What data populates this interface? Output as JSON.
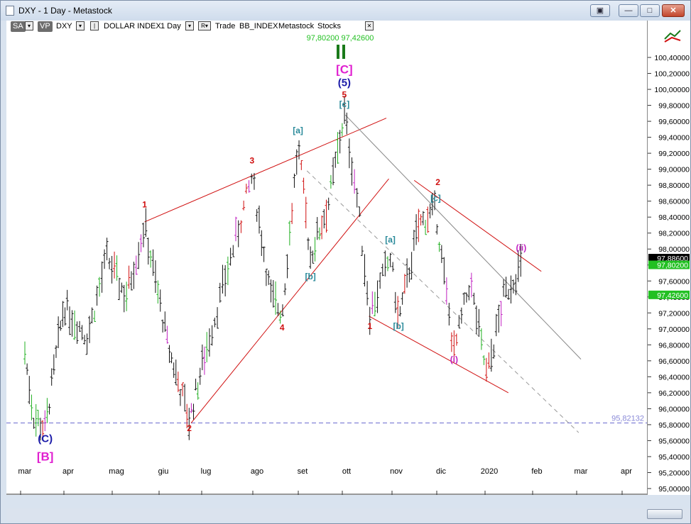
{
  "window": {
    "title": "DXY - 1 Day - Metastock",
    "buttons": [
      "▣",
      "—",
      "□",
      "✕"
    ]
  },
  "toolbar": {
    "sa": "SA",
    "vp": "VP",
    "symbol": "DXY",
    "dd1": "▾",
    "dd2": "▾",
    "name": "DOLLAR INDEX",
    "period": "1 Day",
    "dd3": "▾",
    "rbtn": "R▾",
    "trade": "Trade",
    "source": "BB_INDEX",
    "metastock": "Metastock",
    "stocks": "Stocks",
    "close": "✕",
    "quote_green": "97,80200",
    "quote_green2": "97,42600"
  },
  "chart_data": {
    "type": "ohlc",
    "x_ticks": [
      "mar",
      "apr",
      "mag",
      "giu",
      "lug",
      "ago",
      "set",
      "ott",
      "nov",
      "dic",
      "2020",
      "feb",
      "mar",
      "apr"
    ],
    "y_ticks": [
      "95,00000",
      "95,20000",
      "95,40000",
      "95,60000",
      "95,80000",
      "96,00000",
      "96,20000",
      "96,40000",
      "96,60000",
      "96,80000",
      "97,00000",
      "97,20000",
      "97,40000",
      "97,60000",
      "97,80000",
      "98,00000",
      "98,20000",
      "98,40000",
      "98,60000",
      "98,80000",
      "99,00000",
      "99,20000",
      "99,40000",
      "99,60000",
      "99,80000",
      "100,00000",
      "100,20000",
      "100,40000"
    ],
    "y_range": [
      94.95,
      100.65
    ],
    "price_tags": [
      {
        "value": 97.886,
        "label": "97,88600",
        "bg": "#000000",
        "fg": "#ffffff"
      },
      {
        "value": 97.802,
        "label": "97,80200",
        "bg": "#22c022",
        "fg": "#ffffff"
      },
      {
        "value": 97.426,
        "label": "97,42600",
        "bg": "#22c022",
        "fg": "#ffffff"
      }
    ],
    "support_line": {
      "value": 95.82132,
      "label": "95,82132"
    },
    "wave_labels": [
      {
        "text": "(C)",
        "date_index": 0.47,
        "price": 95.58,
        "color": "#1a1aa8"
      },
      {
        "text": "[B]",
        "date_index": 0.47,
        "price": 95.35,
        "color": "#e020d0"
      },
      {
        "text": "1",
        "date_index": 2.6,
        "price": 98.52,
        "color": "#d01010"
      },
      {
        "text": "2",
        "date_index": 3.61,
        "price": 95.72,
        "color": "#d01010"
      },
      {
        "text": "3",
        "date_index": 4.9,
        "price": 99.07,
        "color": "#d01010"
      },
      {
        "text": "4",
        "date_index": 5.55,
        "price": 96.98,
        "color": "#d01010"
      },
      {
        "text": "[a]",
        "date_index": 5.9,
        "price": 99.45,
        "color": "#2a8a9a"
      },
      {
        "text": "[b]",
        "date_index": 6.18,
        "price": 97.62,
        "color": "#2a8a9a"
      },
      {
        "text": "[c]",
        "date_index": 6.95,
        "price": 99.78,
        "color": "#2a8a9a"
      },
      {
        "text": "5",
        "date_index": 6.95,
        "price": 99.9,
        "color": "#d01010"
      },
      {
        "text": "(5)",
        "date_index": 6.95,
        "price": 100.04,
        "color": "#1a1aa8"
      },
      {
        "text": "[C]",
        "date_index": 6.95,
        "price": 100.2,
        "color": "#e020d0"
      },
      {
        "text": "1",
        "date_index": 7.47,
        "price": 97.0,
        "color": "#d01010"
      },
      {
        "text": "[a]",
        "date_index": 7.88,
        "price": 98.08,
        "color": "#2a8a9a"
      },
      {
        "text": "[b]",
        "date_index": 8.05,
        "price": 97.0,
        "color": "#2a8a9a"
      },
      {
        "text": "[c]",
        "date_index": 8.88,
        "price": 98.6,
        "color": "#2a8a9a"
      },
      {
        "text": "2",
        "date_index": 8.93,
        "price": 98.8,
        "color": "#d01010"
      },
      {
        "text": "(i)",
        "date_index": 9.27,
        "price": 96.58,
        "color": "#c020c0"
      },
      {
        "text": "(ii)",
        "date_index": 10.67,
        "price": 97.98,
        "color": "#c020c0"
      }
    ]
  }
}
